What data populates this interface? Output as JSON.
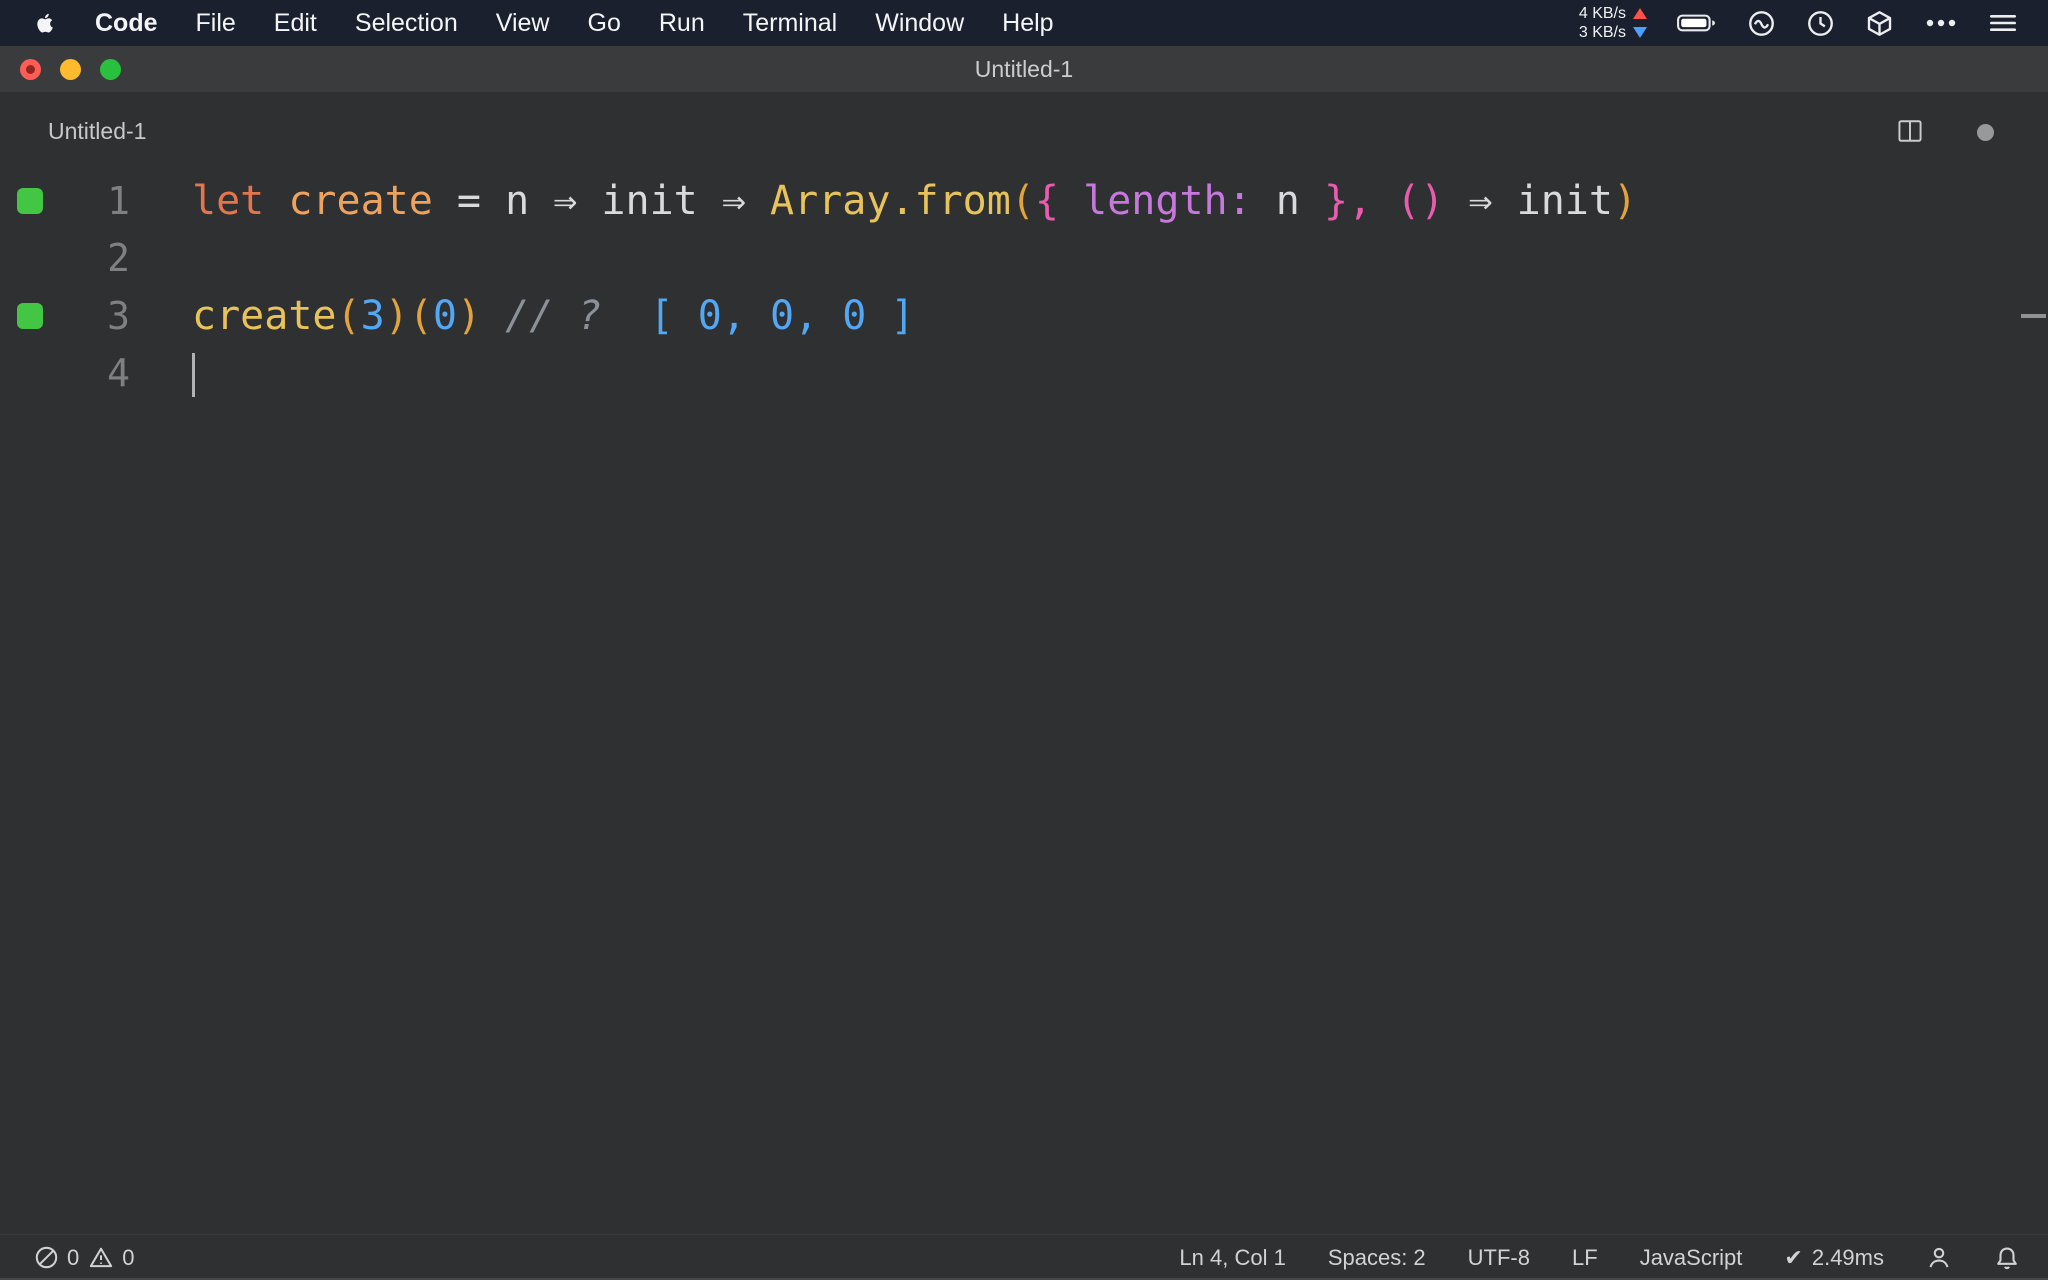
{
  "menubar": {
    "items": [
      "Code",
      "File",
      "Edit",
      "Selection",
      "View",
      "Go",
      "Run",
      "Terminal",
      "Window",
      "Help"
    ],
    "network_up": "4 KB/s",
    "network_down": "3 KB/s"
  },
  "titlebar": {
    "title": "Untitled-1"
  },
  "editor": {
    "label": "Untitled-1",
    "lines": [
      {
        "number": "1",
        "marker": true,
        "cursor": false,
        "tokens": [
          {
            "t": "let",
            "c": "keyword"
          },
          {
            "t": " ",
            "c": "fg"
          },
          {
            "t": "create",
            "c": "decl"
          },
          {
            "t": " = n ⇒ init ⇒ ",
            "c": "fg"
          },
          {
            "t": "Array.from",
            "c": "func"
          },
          {
            "t": "(",
            "c": "bracket1"
          },
          {
            "t": "{",
            "c": "bracket2"
          },
          {
            "t": " ",
            "c": "fg"
          },
          {
            "t": "length:",
            "c": "purple"
          },
          {
            "t": " n ",
            "c": "fg"
          },
          {
            "t": "},",
            "c": "bracket2"
          },
          {
            "t": " ",
            "c": "fg"
          },
          {
            "t": "()",
            "c": "bracket2"
          },
          {
            "t": " ⇒ init",
            "c": "fg"
          },
          {
            "t": ")",
            "c": "bracket1"
          }
        ]
      },
      {
        "number": "2",
        "marker": false,
        "cursor": false,
        "tokens": []
      },
      {
        "number": "3",
        "marker": true,
        "cursor": false,
        "tokens": [
          {
            "t": "create",
            "c": "func"
          },
          {
            "t": "(",
            "c": "bracket1"
          },
          {
            "t": "3",
            "c": "number"
          },
          {
            "t": ")(",
            "c": "bracket1"
          },
          {
            "t": "0",
            "c": "number"
          },
          {
            "t": ")",
            "c": "bracket1"
          },
          {
            "t": " ",
            "c": "fg"
          },
          {
            "t": "// ?",
            "c": "comment"
          },
          {
            "t": "  ",
            "c": "fg"
          },
          {
            "t": "[ 0, 0, 0 ]",
            "c": "output"
          }
        ]
      },
      {
        "number": "4",
        "marker": false,
        "cursor": true,
        "tokens": []
      }
    ]
  },
  "statusbar": {
    "errors": "0",
    "warnings": "0",
    "cursor_position": "Ln 4, Col 1",
    "indentation": "Spaces: 2",
    "encoding": "UTF-8",
    "eol": "LF",
    "language": "JavaScript",
    "check": "✔",
    "perf": "2.49ms"
  },
  "colors": {
    "syntax": {
      "fg": "#d8dade",
      "keyword": "#e4754d",
      "decl": "#eda35f",
      "func": "#e8c25a",
      "bracket1": "#e2a23c",
      "bracket2": "#e95caf",
      "purple": "#c678dd",
      "number": "#54a7f2",
      "comment": "#8b9198",
      "output": "#54a7f2"
    },
    "marker_green": "#44c645",
    "upload_arrow": "#ff5148",
    "download_arrow": "#4da0ff",
    "traffic_red": "#ff5d55",
    "traffic_yellow": "#febb2e",
    "traffic_green": "#2ac03f"
  }
}
